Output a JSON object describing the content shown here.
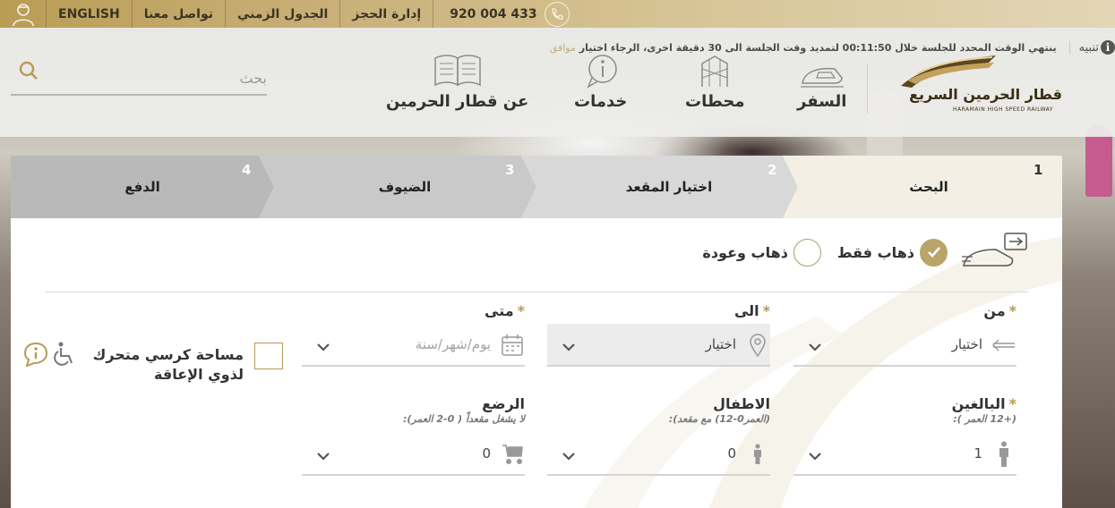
{
  "topbar": {
    "language": "ENGLISH",
    "contact": "تواصل معنا",
    "schedule": "الجدول الزمني",
    "manage_booking": "إدارة الحجز",
    "phone": "920 004 433"
  },
  "notice": {
    "label": "تنبيه",
    "message": "ينتهي الوقت المحدد للجلسة خلال 00:11:50  لتمديد وقت الجلسة الى 30 دقيقة اخرى، الرجاء اختيار",
    "ok": "موافق"
  },
  "logo": {
    "name_ar": "قطار الحرمين السريع",
    "name_en": "HARAMAIN HIGH SPEED RAILWAY"
  },
  "nav": {
    "travel": "السفر",
    "stations": "محطات",
    "services": "خدمات",
    "about": "عن قطار الحرمين"
  },
  "search": {
    "placeholder": "بحث"
  },
  "steps": [
    {
      "num": "1",
      "label": "البحث"
    },
    {
      "num": "2",
      "label": "اختيار المقعد"
    },
    {
      "num": "3",
      "label": "الضيوف"
    },
    {
      "num": "4",
      "label": "الدفع"
    }
  ],
  "trip": {
    "one_way": "ذهاب فقط",
    "round_trip": "ذهاب وعودة",
    "selected": "one_way"
  },
  "form": {
    "from": {
      "label": "من",
      "required": "*",
      "value": "اختيار"
    },
    "to": {
      "label": "الى",
      "required": "*",
      "value": "اختيار"
    },
    "when": {
      "label": "متى",
      "required": "*",
      "placeholder": "يوم/شهر/سنة"
    },
    "adults": {
      "label": "البالغين",
      "required": "*",
      "sub": "(+12 العمر ):",
      "value": "1"
    },
    "children": {
      "label": "الاطفال",
      "sub": "(العمر0-12) مع مقعد):",
      "value": "0"
    },
    "infants": {
      "label": "الرضع",
      "sub": "لا يشغل مقعداً ( 0-2 العمر):",
      "value": "0"
    }
  },
  "wheelchair": {
    "label": "مساحة كرسي متحرك\nلذوي الإعاقة"
  },
  "colors": {
    "gold": "#b69a55",
    "active_step": "#f3efe4",
    "inactive_step": "#cfcfcf",
    "top_bar": "#c9b079"
  }
}
